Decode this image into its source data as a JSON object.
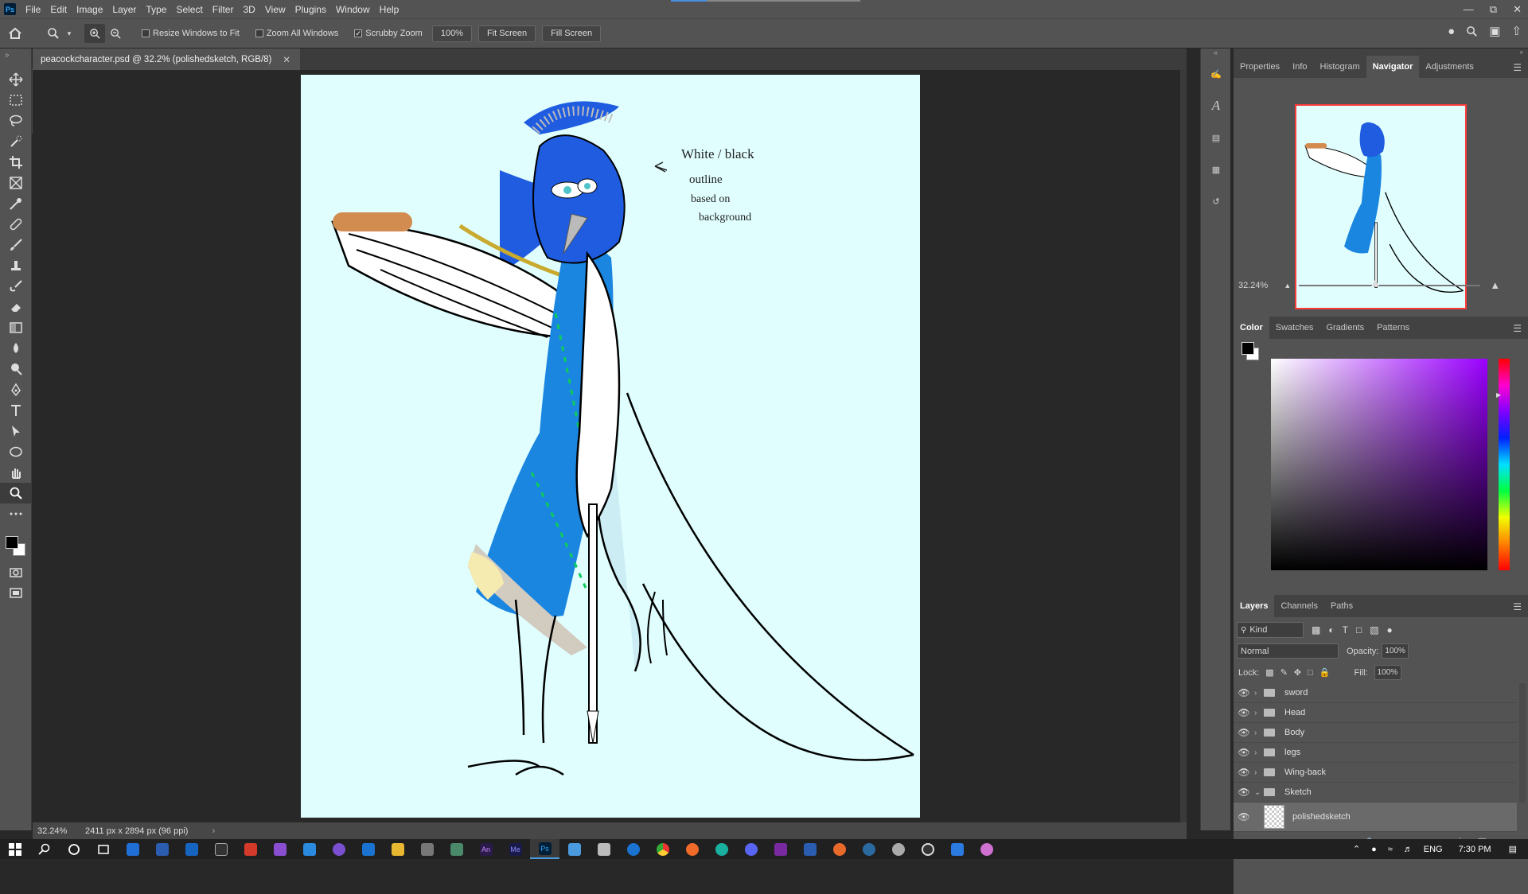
{
  "app": {
    "logo": "Ps"
  },
  "menu": [
    "File",
    "Edit",
    "Image",
    "Layer",
    "Type",
    "Select",
    "Filter",
    "3D",
    "View",
    "Plugins",
    "Window",
    "Help"
  ],
  "options": {
    "resize_windows": "Resize Windows to Fit",
    "zoom_all": "Zoom All Windows",
    "scrubby": "Scrubby Zoom",
    "zoom_value": "100%",
    "fit_screen": "Fit Screen",
    "fill_screen": "Fill Screen"
  },
  "document": {
    "tab_title": "peacockcharacter.psd @ 32.2% (polishedsketch, RGB/8)",
    "note": [
      "White / black",
      "outline",
      "based on",
      "background"
    ]
  },
  "status": {
    "zoom": "32.24%",
    "dims": "2411 px x 2894 px (96 ppi)"
  },
  "panels": {
    "top_tabs": [
      "Properties",
      "Info",
      "Histogram",
      "Navigator",
      "Adjustments"
    ],
    "active_top": "Navigator",
    "nav_zoom": "32.24%",
    "color_tabs": [
      "Color",
      "Swatches",
      "Gradients",
      "Patterns"
    ],
    "layer_tabs": [
      "Layers",
      "Channels",
      "Paths"
    ],
    "kind": "Kind",
    "blend_mode": "Normal",
    "opacity_label": "Opacity:",
    "opacity": "100%",
    "lock_label": "Lock:",
    "fill_label": "Fill:",
    "fill": "100%"
  },
  "layers": [
    {
      "name": "sword"
    },
    {
      "name": "Head"
    },
    {
      "name": "Body"
    },
    {
      "name": "legs"
    },
    {
      "name": "Wing-back"
    },
    {
      "name": "Sketch"
    },
    {
      "name": "polishedsketch"
    }
  ],
  "taskbar": {
    "lang": "ENG",
    "time": "7:30 PM",
    "apps": [
      "start",
      "search",
      "cortana",
      "task-view",
      "store",
      "ps-express",
      "terminal",
      "app-red",
      "visual-studio",
      "vscode",
      "github",
      "outlook",
      "file-explorer",
      "photos",
      "app-misc",
      "animate",
      "media-encoder",
      "photoshop",
      "notepad",
      "sticky",
      "edge-legacy",
      "chrome",
      "firefox",
      "edge",
      "discord",
      "onenote",
      "word",
      "app-orange",
      "app-blue",
      "app-grey",
      "app-obs",
      "app-calendar",
      "app-pink"
    ]
  },
  "colors": {
    "accent": "#31a8ff",
    "canvas_bg": "#e0fefe",
    "nav_frame": "#ff3a3a"
  }
}
